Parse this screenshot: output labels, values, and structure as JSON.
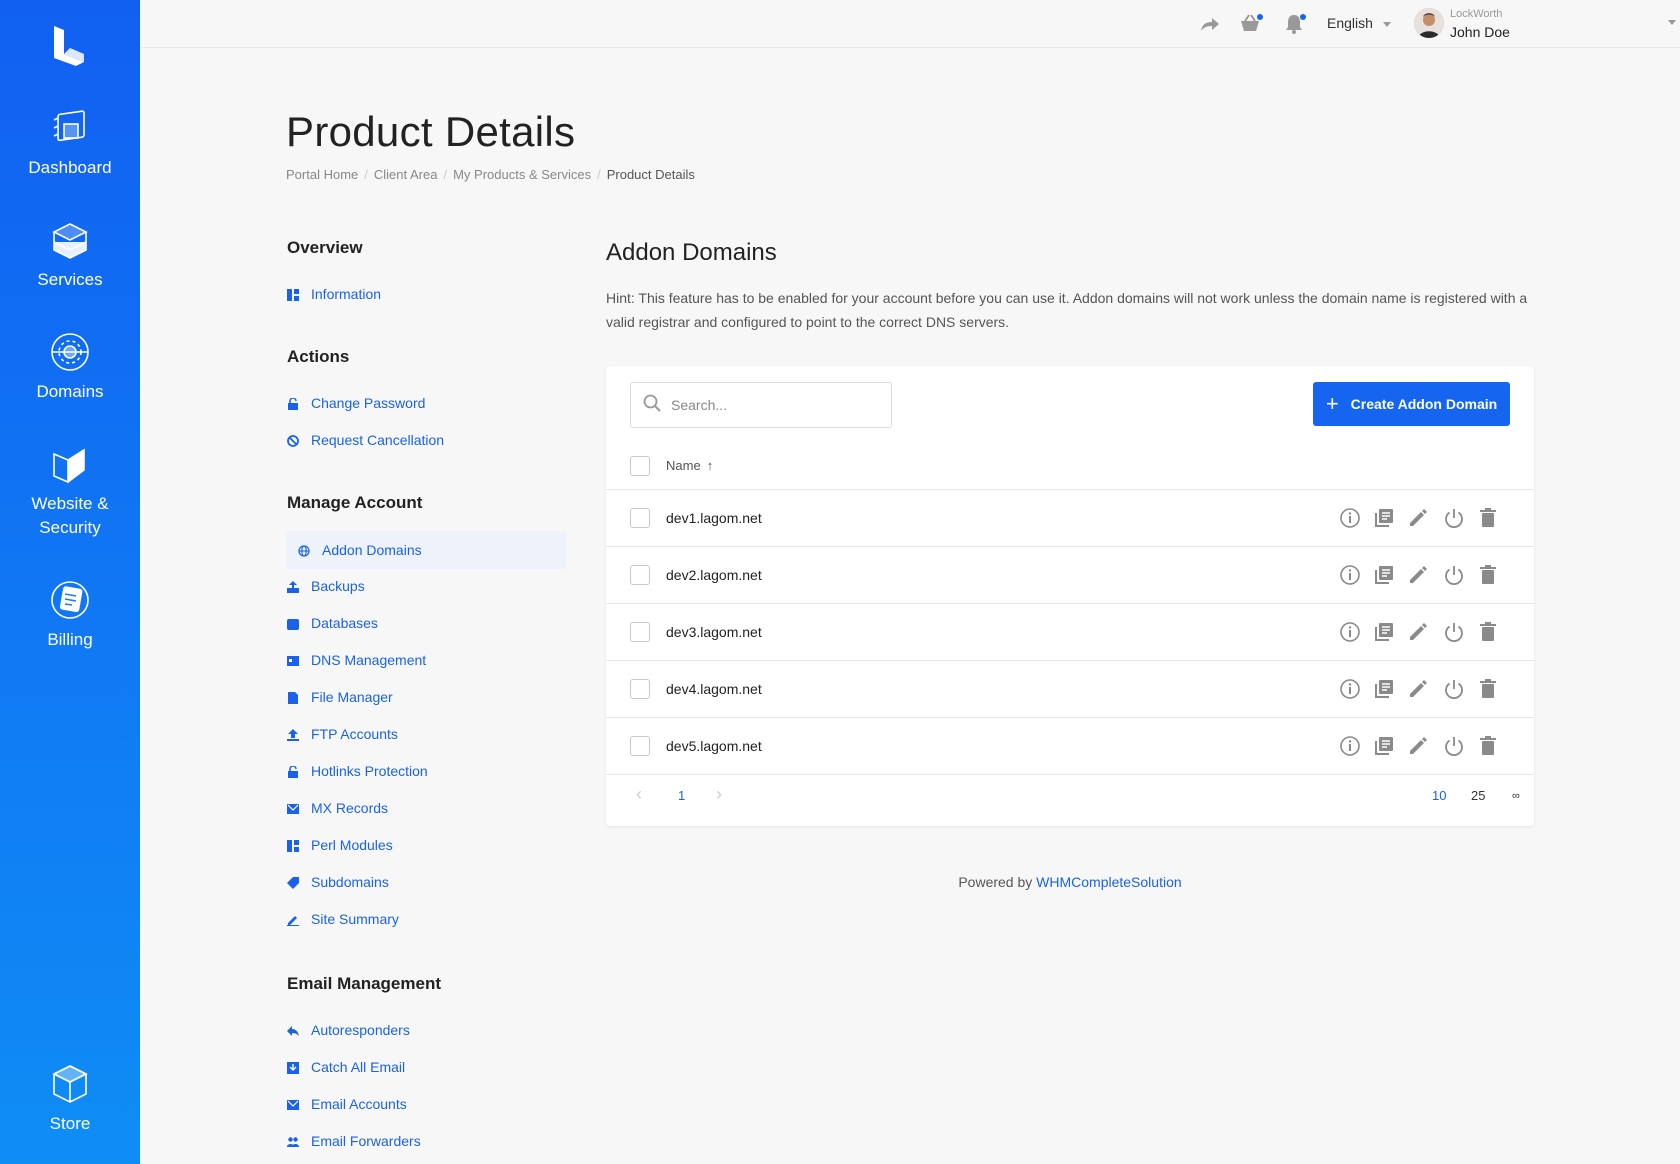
{
  "colors": {
    "accent": "#1565f1",
    "sidebar_top": "#1160f2",
    "sidebar_bottom": "#0f8df5"
  },
  "sidebar": {
    "logo": "lagom-logo-icon",
    "items": [
      {
        "label": "Dashboard",
        "icon": "dashboard-icon"
      },
      {
        "label": "Services",
        "icon": "services-icon"
      },
      {
        "label": "Domains",
        "icon": "domains-icon"
      },
      {
        "label_line1": "Website &",
        "label_line2": "Security",
        "icon": "website-security-icon"
      },
      {
        "label": "Billing",
        "icon": "billing-icon"
      },
      {
        "label": "Store",
        "icon": "store-icon"
      }
    ]
  },
  "topbar": {
    "language": "English",
    "user_company": "LockWorth",
    "user_name": "John Doe"
  },
  "page": {
    "title": "Product Details",
    "breadcrumb": [
      "Portal Home",
      "Client Area",
      "My Products & Services",
      "Product Details"
    ]
  },
  "menu": {
    "overview": {
      "heading": "Overview",
      "items": [
        "Information"
      ]
    },
    "actions": {
      "heading": "Actions",
      "items": [
        "Change Password",
        "Request Cancellation"
      ]
    },
    "manage": {
      "heading": "Manage Account",
      "items": [
        "Addon Domains",
        "Backups",
        "Databases",
        "DNS Management",
        "File Manager",
        "FTP Accounts",
        "Hotlinks Protection",
        "MX Records",
        "Perl Modules",
        "Subdomains",
        "Site Summary"
      ],
      "active": "Addon Domains"
    },
    "email": {
      "heading": "Email Management",
      "items": [
        "Autoresponders",
        "Catch All Email",
        "Email Accounts",
        "Email Forwarders"
      ]
    }
  },
  "content": {
    "title": "Addon Domains",
    "hint": "Hint: This feature has to be enabled for your account before you can use it. Addon domains will not work unless the domain name is registered with a valid registrar and configured to point to the correct DNS servers.",
    "search_placeholder": "Search...",
    "create_button": "Create Addon Domain",
    "column_name": "Name",
    "sort_arrow": "↑",
    "domains": [
      "dev1.lagom.net",
      "dev2.lagom.net",
      "dev3.lagom.net",
      "dev4.lagom.net",
      "dev5.lagom.net"
    ],
    "row_actions": [
      "info-icon",
      "details-icon",
      "edit-icon",
      "power-icon",
      "delete-icon"
    ],
    "pagination": {
      "prev": "‹",
      "current": "1",
      "next": "›",
      "sizes": [
        "10",
        "25",
        "∞"
      ],
      "selected_size": "10"
    }
  },
  "footer": {
    "prefix": "Powered by",
    "link": "WHMCompleteSolution"
  }
}
